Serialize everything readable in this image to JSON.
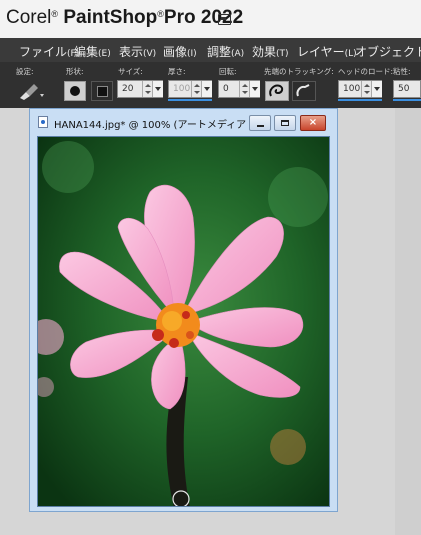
{
  "app": {
    "brand": "Corel",
    "product": "PaintShop",
    "pro": "Pro",
    "year": "2022",
    "reg": "®"
  },
  "menu": [
    {
      "label": "ファイル",
      "key": "(F)"
    },
    {
      "label": "編集",
      "key": "(E)"
    },
    {
      "label": "表示",
      "key": "(V)"
    },
    {
      "label": "画像",
      "key": "(I)"
    },
    {
      "label": "調整",
      "key": "(A)"
    },
    {
      "label": "効果",
      "key": "(T)"
    },
    {
      "label": "レイヤー",
      "key": "(L)"
    },
    {
      "label": "オブジェクト",
      "key": "(O)"
    }
  ],
  "toolbar": {
    "presets_label": "設定:",
    "shape_label": "形状:",
    "size_label": "サイズ:",
    "size_value": "20",
    "thickness_label": "厚さ:",
    "thickness_value": "100",
    "rotation_label": "回転:",
    "rotation_value": "0",
    "tip_tracking_label": "先端のトラッキング:",
    "head_load_label": "ヘッドのロード:",
    "head_load_value": "100",
    "viscosity_label": "粘性:",
    "viscosity_value": "50"
  },
  "document": {
    "title": "HANA144.jpg* @ 100% (アートメディア 1)"
  },
  "colors": {
    "menubar": "#3a3a3a",
    "toolbar": "#303030",
    "accent": "#3b8fe0",
    "petal": "#f4a9cf",
    "center": "#f28b1c"
  }
}
